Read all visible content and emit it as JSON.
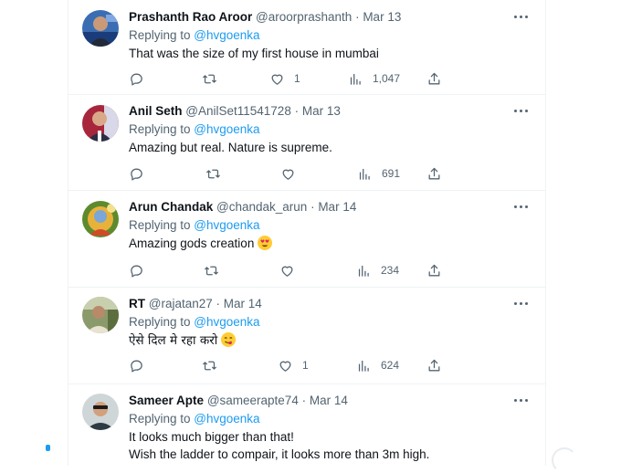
{
  "replies": [
    {
      "name": "Prashanth Rao Aroor",
      "handle": "@aroorprashanth",
      "sep": " · ",
      "date": "Mar 13",
      "replying_prefix": "Replying to ",
      "replying_handle": "@hvgoenka",
      "text_lines": [
        "That was the size of my first house in mumbai"
      ],
      "emoji": "",
      "stats": {
        "replies": "",
        "retweets": "",
        "likes": "1",
        "views": "1,047"
      }
    },
    {
      "name": "Anil Seth",
      "handle": "@AnilSet11541728",
      "sep": " · ",
      "date": "Mar 13",
      "replying_prefix": "Replying to ",
      "replying_handle": "@hvgoenka",
      "text_lines": [
        "Amazing but real. Nature is supreme."
      ],
      "emoji": "",
      "stats": {
        "replies": "",
        "retweets": "",
        "likes": "",
        "views": "691"
      }
    },
    {
      "name": "Arun Chandak",
      "handle": "@chandak_arun",
      "sep": " · ",
      "date": "Mar 14",
      "replying_prefix": "Replying to ",
      "replying_handle": "@hvgoenka",
      "text_lines": [
        "Amazing gods creation"
      ],
      "emoji": "heart-eyes-emoji",
      "stats": {
        "replies": "",
        "retweets": "",
        "likes": "",
        "views": "234"
      }
    },
    {
      "name": "RT",
      "handle": "@rajatan27",
      "sep": " · ",
      "date": "Mar 14",
      "replying_prefix": "Replying to ",
      "replying_handle": "@hvgoenka",
      "text_lines": [
        "ऐसे दिल मे रहा करो"
      ],
      "emoji": "yum-emoji",
      "stats": {
        "replies": "",
        "retweets": "",
        "likes": "1",
        "views": "624"
      }
    },
    {
      "name": "Sameer Apte",
      "handle": "@sameerapte74",
      "sep": " · ",
      "date": "Mar 14",
      "replying_prefix": "Replying to ",
      "replying_handle": "@hvgoenka",
      "text_lines": [
        "It looks much bigger than that!",
        "Wish the ladder to compair, it looks more than 3m high."
      ],
      "emoji": "",
      "stats": {
        "replies": "",
        "retweets": "",
        "likes": "",
        "views": ""
      }
    }
  ],
  "colors": {
    "accent": "#1d9bf0",
    "text": "#0f1419",
    "muted": "#536471",
    "divider": "#eff3f4"
  },
  "icons": [
    "reply-icon",
    "retweet-icon",
    "like-icon",
    "views-icon",
    "share-icon",
    "more-icon"
  ]
}
